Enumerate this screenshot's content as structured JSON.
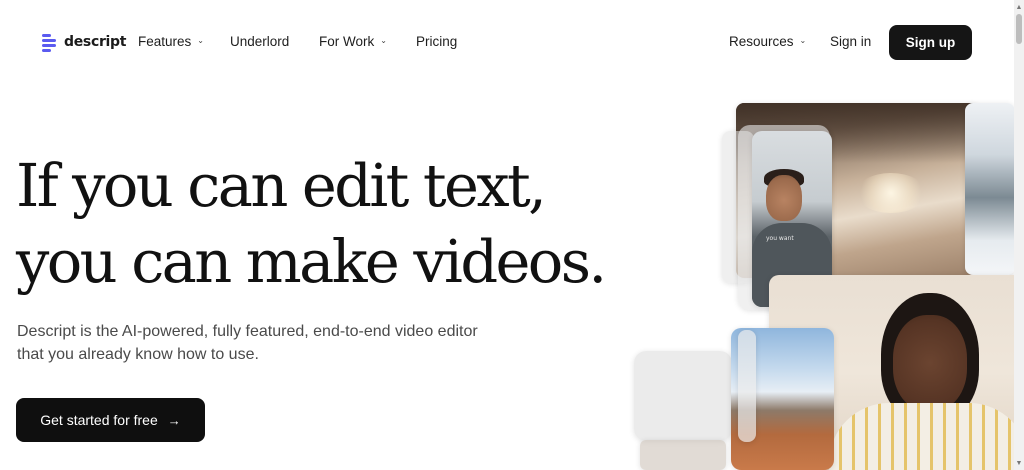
{
  "nav": {
    "logo_text": "descript",
    "items": [
      {
        "label": "Features",
        "has_dropdown": true
      },
      {
        "label": "Underlord",
        "has_dropdown": false
      },
      {
        "label": "For Work",
        "has_dropdown": true
      },
      {
        "label": "Pricing",
        "has_dropdown": false
      }
    ],
    "resources_label": "Resources",
    "signin_label": "Sign in",
    "signup_label": "Sign up",
    "chevron_glyph": "⌄"
  },
  "hero": {
    "headline_lines": [
      "If you can edit text,",
      "you can make videos."
    ],
    "subtext_lines": [
      "Descript is the AI-powered, fully featured, end-to-end video editor",
      "that you already know how to use."
    ],
    "cta_label": "Get started for free",
    "cta_arrow": "→"
  },
  "collage": {
    "man_shirt_text": "you want"
  },
  "colors": {
    "brand": "#5b5bf0",
    "button_dark": "#151515",
    "text": "#141414",
    "subtext": "#4a4a4a"
  },
  "icons": {
    "logo": "descript-logo-icon",
    "dropdown": "chevron-down-icon",
    "cta": "arrow-right-icon"
  }
}
